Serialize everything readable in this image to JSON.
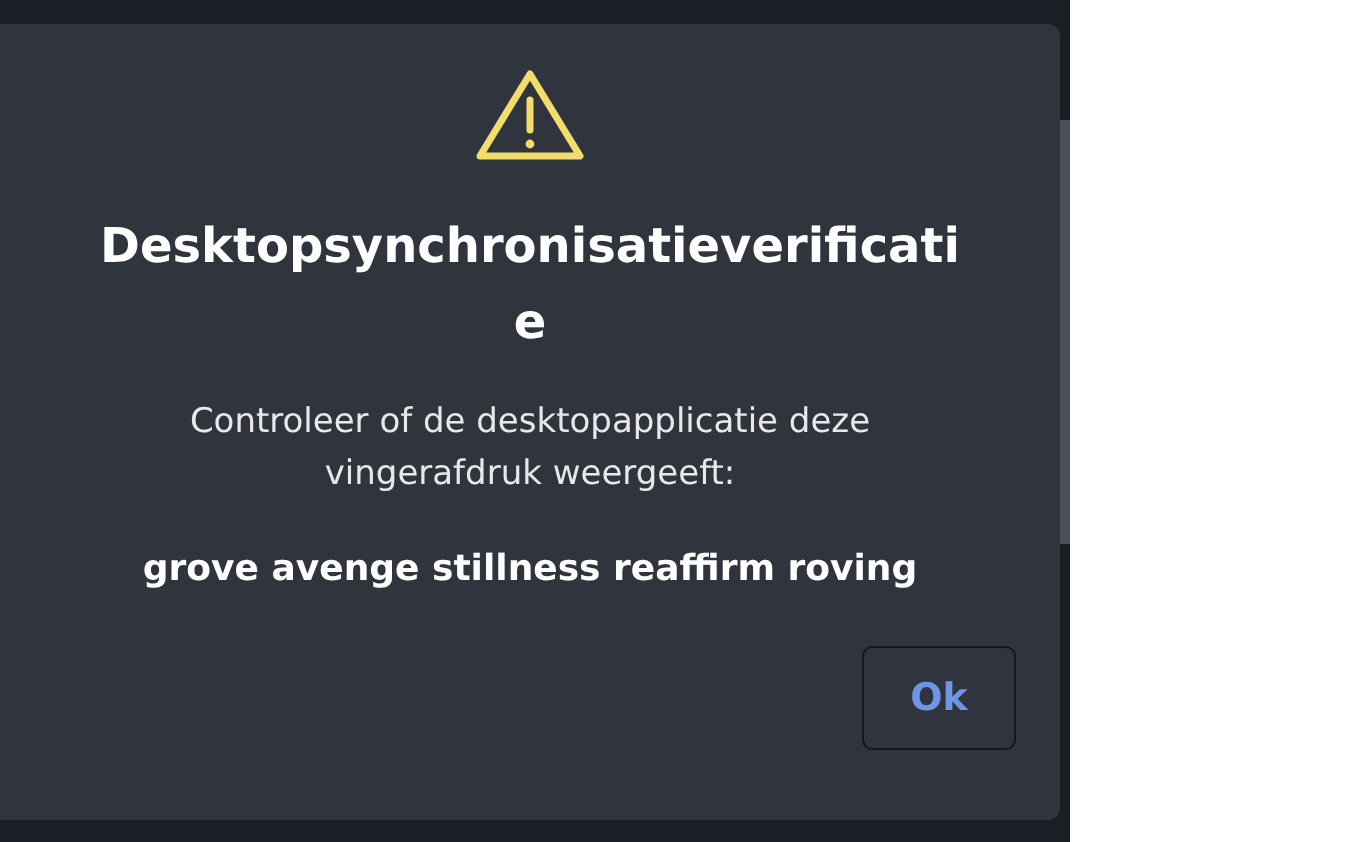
{
  "dialog": {
    "title": "Desktopsynchronisatieverificatie",
    "message": "Controleer of de desktopapplicatie deze vingerafdruk weergeeft:",
    "fingerprint": "grove avenge stillness reaffirm roving",
    "buttons": [
      "Ok"
    ]
  }
}
